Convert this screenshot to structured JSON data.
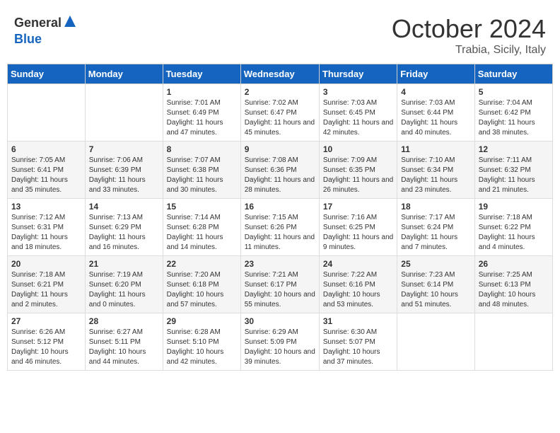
{
  "header": {
    "logo_general": "General",
    "logo_blue": "Blue",
    "month": "October 2024",
    "location": "Trabia, Sicily, Italy"
  },
  "days_of_week": [
    "Sunday",
    "Monday",
    "Tuesday",
    "Wednesday",
    "Thursday",
    "Friday",
    "Saturday"
  ],
  "weeks": [
    [
      {
        "day": "",
        "sunrise": "",
        "sunset": "",
        "daylight": ""
      },
      {
        "day": "",
        "sunrise": "",
        "sunset": "",
        "daylight": ""
      },
      {
        "day": "1",
        "sunrise": "Sunrise: 7:01 AM",
        "sunset": "Sunset: 6:49 PM",
        "daylight": "Daylight: 11 hours and 47 minutes."
      },
      {
        "day": "2",
        "sunrise": "Sunrise: 7:02 AM",
        "sunset": "Sunset: 6:47 PM",
        "daylight": "Daylight: 11 hours and 45 minutes."
      },
      {
        "day": "3",
        "sunrise": "Sunrise: 7:03 AM",
        "sunset": "Sunset: 6:45 PM",
        "daylight": "Daylight: 11 hours and 42 minutes."
      },
      {
        "day": "4",
        "sunrise": "Sunrise: 7:03 AM",
        "sunset": "Sunset: 6:44 PM",
        "daylight": "Daylight: 11 hours and 40 minutes."
      },
      {
        "day": "5",
        "sunrise": "Sunrise: 7:04 AM",
        "sunset": "Sunset: 6:42 PM",
        "daylight": "Daylight: 11 hours and 38 minutes."
      }
    ],
    [
      {
        "day": "6",
        "sunrise": "Sunrise: 7:05 AM",
        "sunset": "Sunset: 6:41 PM",
        "daylight": "Daylight: 11 hours and 35 minutes."
      },
      {
        "day": "7",
        "sunrise": "Sunrise: 7:06 AM",
        "sunset": "Sunset: 6:39 PM",
        "daylight": "Daylight: 11 hours and 33 minutes."
      },
      {
        "day": "8",
        "sunrise": "Sunrise: 7:07 AM",
        "sunset": "Sunset: 6:38 PM",
        "daylight": "Daylight: 11 hours and 30 minutes."
      },
      {
        "day": "9",
        "sunrise": "Sunrise: 7:08 AM",
        "sunset": "Sunset: 6:36 PM",
        "daylight": "Daylight: 11 hours and 28 minutes."
      },
      {
        "day": "10",
        "sunrise": "Sunrise: 7:09 AM",
        "sunset": "Sunset: 6:35 PM",
        "daylight": "Daylight: 11 hours and 26 minutes."
      },
      {
        "day": "11",
        "sunrise": "Sunrise: 7:10 AM",
        "sunset": "Sunset: 6:34 PM",
        "daylight": "Daylight: 11 hours and 23 minutes."
      },
      {
        "day": "12",
        "sunrise": "Sunrise: 7:11 AM",
        "sunset": "Sunset: 6:32 PM",
        "daylight": "Daylight: 11 hours and 21 minutes."
      }
    ],
    [
      {
        "day": "13",
        "sunrise": "Sunrise: 7:12 AM",
        "sunset": "Sunset: 6:31 PM",
        "daylight": "Daylight: 11 hours and 18 minutes."
      },
      {
        "day": "14",
        "sunrise": "Sunrise: 7:13 AM",
        "sunset": "Sunset: 6:29 PM",
        "daylight": "Daylight: 11 hours and 16 minutes."
      },
      {
        "day": "15",
        "sunrise": "Sunrise: 7:14 AM",
        "sunset": "Sunset: 6:28 PM",
        "daylight": "Daylight: 11 hours and 14 minutes."
      },
      {
        "day": "16",
        "sunrise": "Sunrise: 7:15 AM",
        "sunset": "Sunset: 6:26 PM",
        "daylight": "Daylight: 11 hours and 11 minutes."
      },
      {
        "day": "17",
        "sunrise": "Sunrise: 7:16 AM",
        "sunset": "Sunset: 6:25 PM",
        "daylight": "Daylight: 11 hours and 9 minutes."
      },
      {
        "day": "18",
        "sunrise": "Sunrise: 7:17 AM",
        "sunset": "Sunset: 6:24 PM",
        "daylight": "Daylight: 11 hours and 7 minutes."
      },
      {
        "day": "19",
        "sunrise": "Sunrise: 7:18 AM",
        "sunset": "Sunset: 6:22 PM",
        "daylight": "Daylight: 11 hours and 4 minutes."
      }
    ],
    [
      {
        "day": "20",
        "sunrise": "Sunrise: 7:18 AM",
        "sunset": "Sunset: 6:21 PM",
        "daylight": "Daylight: 11 hours and 2 minutes."
      },
      {
        "day": "21",
        "sunrise": "Sunrise: 7:19 AM",
        "sunset": "Sunset: 6:20 PM",
        "daylight": "Daylight: 11 hours and 0 minutes."
      },
      {
        "day": "22",
        "sunrise": "Sunrise: 7:20 AM",
        "sunset": "Sunset: 6:18 PM",
        "daylight": "Daylight: 10 hours and 57 minutes."
      },
      {
        "day": "23",
        "sunrise": "Sunrise: 7:21 AM",
        "sunset": "Sunset: 6:17 PM",
        "daylight": "Daylight: 10 hours and 55 minutes."
      },
      {
        "day": "24",
        "sunrise": "Sunrise: 7:22 AM",
        "sunset": "Sunset: 6:16 PM",
        "daylight": "Daylight: 10 hours and 53 minutes."
      },
      {
        "day": "25",
        "sunrise": "Sunrise: 7:23 AM",
        "sunset": "Sunset: 6:14 PM",
        "daylight": "Daylight: 10 hours and 51 minutes."
      },
      {
        "day": "26",
        "sunrise": "Sunrise: 7:25 AM",
        "sunset": "Sunset: 6:13 PM",
        "daylight": "Daylight: 10 hours and 48 minutes."
      }
    ],
    [
      {
        "day": "27",
        "sunrise": "Sunrise: 6:26 AM",
        "sunset": "Sunset: 5:12 PM",
        "daylight": "Daylight: 10 hours and 46 minutes."
      },
      {
        "day": "28",
        "sunrise": "Sunrise: 6:27 AM",
        "sunset": "Sunset: 5:11 PM",
        "daylight": "Daylight: 10 hours and 44 minutes."
      },
      {
        "day": "29",
        "sunrise": "Sunrise: 6:28 AM",
        "sunset": "Sunset: 5:10 PM",
        "daylight": "Daylight: 10 hours and 42 minutes."
      },
      {
        "day": "30",
        "sunrise": "Sunrise: 6:29 AM",
        "sunset": "Sunset: 5:09 PM",
        "daylight": "Daylight: 10 hours and 39 minutes."
      },
      {
        "day": "31",
        "sunrise": "Sunrise: 6:30 AM",
        "sunset": "Sunset: 5:07 PM",
        "daylight": "Daylight: 10 hours and 37 minutes."
      },
      {
        "day": "",
        "sunrise": "",
        "sunset": "",
        "daylight": ""
      },
      {
        "day": "",
        "sunrise": "",
        "sunset": "",
        "daylight": ""
      }
    ]
  ]
}
